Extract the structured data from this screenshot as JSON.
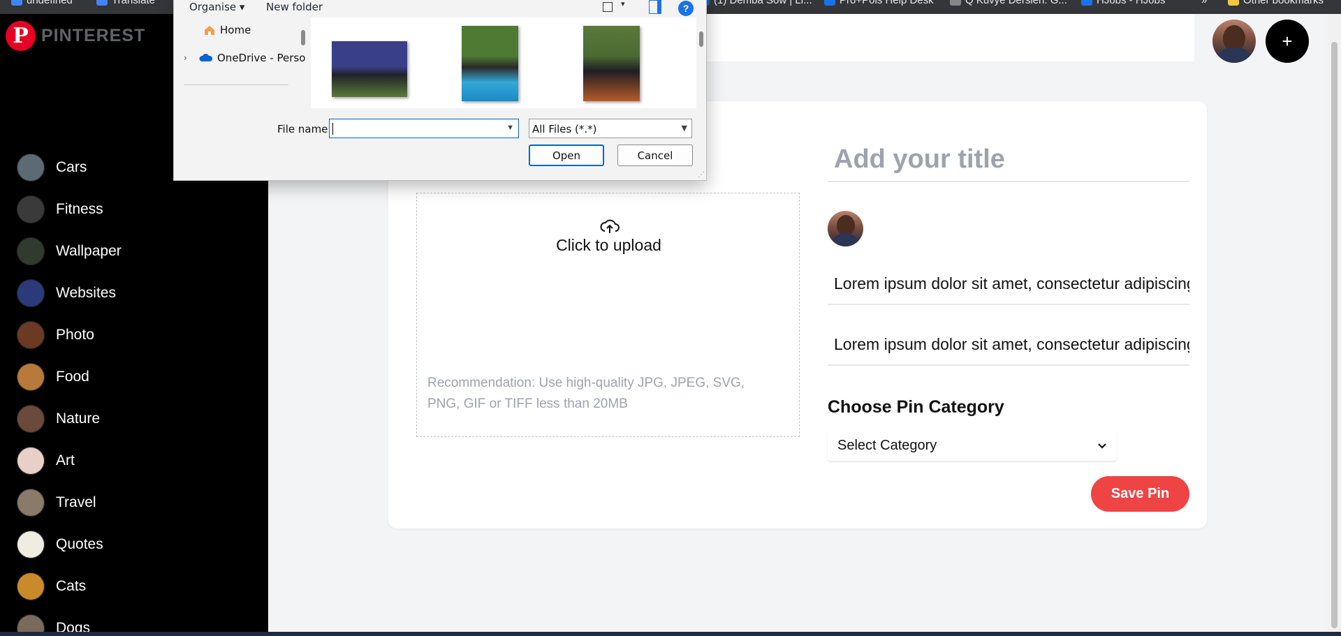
{
  "bookmarks": [
    {
      "label": "undefined",
      "color": "#4285f4"
    },
    {
      "label": "Translate",
      "color": "#4285f4"
    },
    {
      "label": "(1) Demba Sow | Li...",
      "color": "#0a66c2"
    },
    {
      "label": "Pro+Pols Help Desk",
      "color": "#1a73e8"
    },
    {
      "label": "Q Kuvye Dersleri: G...",
      "color": "#888888"
    },
    {
      "label": "HJobs - HJobs",
      "color": "#1a73e8"
    },
    {
      "label": "»",
      "color": "#35363a"
    },
    {
      "label": "Other bookmarks",
      "color": "#f4c542"
    }
  ],
  "app": {
    "logo_text": "PINTEREST",
    "logo_mark": "P",
    "brand_color": "#e60023",
    "add_button": "+"
  },
  "sidebar": {
    "categories": [
      {
        "label": "Cars",
        "thumb": "#5b6a73"
      },
      {
        "label": "Fitness",
        "thumb": "#3a3a3a"
      },
      {
        "label": "Wallpaper",
        "thumb": "#2f3b2f"
      },
      {
        "label": "Websites",
        "thumb": "#2a3a7a"
      },
      {
        "label": "Photo",
        "thumb": "#6b3a22"
      },
      {
        "label": "Food",
        "thumb": "#b77a3a"
      },
      {
        "label": "Nature",
        "thumb": "#6a4a3a"
      },
      {
        "label": "Art",
        "thumb": "#e8d0c8"
      },
      {
        "label": "Travel",
        "thumb": "#8a7a6a"
      },
      {
        "label": "Quotes",
        "thumb": "#f0ece2"
      },
      {
        "label": "Cats",
        "thumb": "#c98a2a"
      },
      {
        "label": "Dogs",
        "thumb": "#7a6a5a"
      }
    ]
  },
  "upload": {
    "icon": "cloud-upload-icon",
    "label": "Click to upload",
    "recommendation": "Recommendation: Use high-quality JPG, JPEG, SVG, PNG, GIF or TIFF less than 20MB"
  },
  "form": {
    "title_placeholder": "Add your title",
    "about_value": "Lorem ipsum dolor sit amet, consectetur adipiscing",
    "destination_value": "Lorem ipsum dolor sit amet, consectetur adipiscing",
    "category_heading": "Choose Pin Category",
    "category_selected": "Select Category",
    "save_label": "Save Pin",
    "save_color": "#ef4444"
  },
  "file_dialog": {
    "organise": "Organise ▾",
    "new_folder": "New folder",
    "help": "?",
    "nav": {
      "home": "Home",
      "onedrive": "OneDrive - Perso"
    },
    "file_name_label": "File name:",
    "file_name_value": "",
    "filter": "All Files (*.*)",
    "open_label": "Open",
    "cancel_label": "Cancel"
  }
}
